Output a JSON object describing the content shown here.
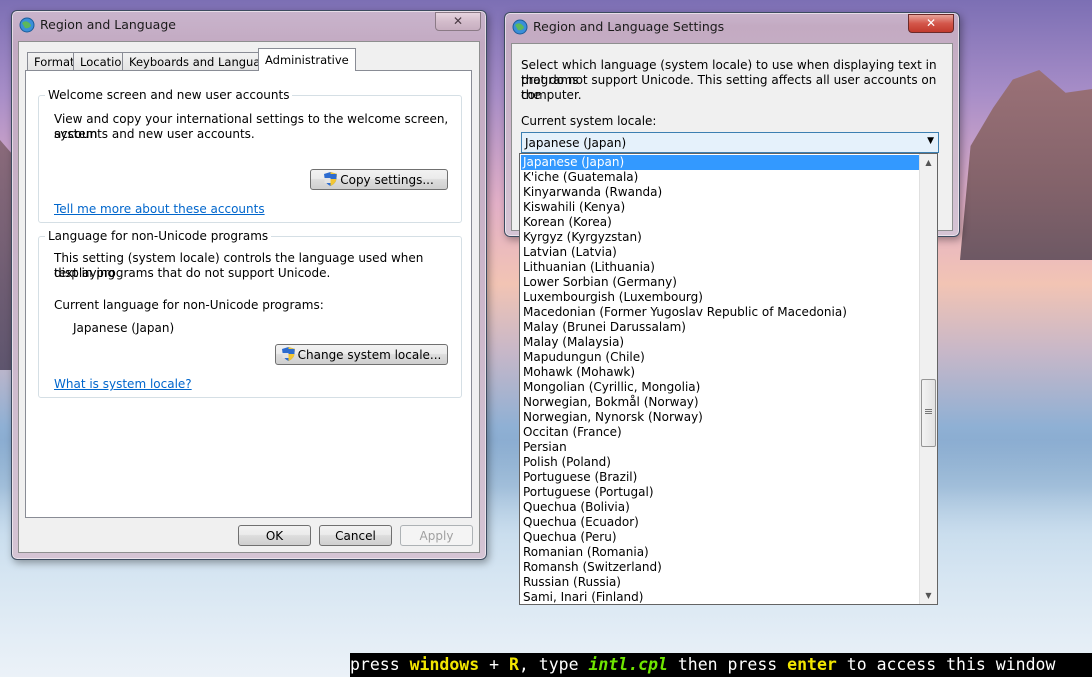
{
  "window1": {
    "title": "Region and Language",
    "close_label": "✕",
    "tabs": [
      "Formats",
      "Location",
      "Keyboards and Languages",
      "Administrative"
    ],
    "group1": {
      "title": "Welcome screen and new user accounts",
      "description_line1": "View and copy your international settings to the welcome screen, system",
      "description_line2": "accounts and new user accounts.",
      "copy_button": "Copy settings...",
      "link": "Tell me more about these accounts"
    },
    "group2": {
      "title": "Language for non-Unicode programs",
      "description_line1": "This setting (system locale) controls the language used when displaying",
      "description_line2": "text in programs that do not support Unicode.",
      "current_label": "Current language for non-Unicode programs:",
      "current_value": "Japanese (Japan)",
      "change_button": "Change system locale...",
      "link": "What is system locale?"
    },
    "buttons": {
      "ok": "OK",
      "cancel": "Cancel",
      "apply": "Apply"
    }
  },
  "window2": {
    "title": "Region and Language Settings",
    "close_label": "✕",
    "description_line1": "Select which language (system locale) to use when displaying text in programs",
    "description_line2": "that do not support Unicode. This setting affects all user accounts on the",
    "description_line3": "computer.",
    "locale_label": "Current system locale:",
    "selected_locale": "Japanese (Japan)",
    "locale_options": [
      "Japanese (Japan)",
      "K'iche (Guatemala)",
      "Kinyarwanda (Rwanda)",
      "Kiswahili (Kenya)",
      "Korean (Korea)",
      "Kyrgyz (Kyrgyzstan)",
      "Latvian (Latvia)",
      "Lithuanian (Lithuania)",
      "Lower Sorbian (Germany)",
      "Luxembourgish (Luxembourg)",
      "Macedonian (Former Yugoslav Republic of Macedonia)",
      "Malay (Brunei Darussalam)",
      "Malay (Malaysia)",
      "Mapudungun (Chile)",
      "Mohawk (Mohawk)",
      "Mongolian (Cyrillic, Mongolia)",
      "Norwegian, Bokmål (Norway)",
      "Norwegian, Nynorsk (Norway)",
      "Occitan (France)",
      "Persian",
      "Polish (Poland)",
      "Portuguese (Brazil)",
      "Portuguese (Portugal)",
      "Quechua (Bolivia)",
      "Quechua (Ecuador)",
      "Quechua (Peru)",
      "Romanian (Romania)",
      "Romansh (Switzerland)",
      "Russian (Russia)",
      "Sami, Inari (Finland)"
    ]
  },
  "instruction": {
    "p1": "press ",
    "k1": "windows",
    "p2": " + ",
    "k2": "R",
    "p3": ", type ",
    "k3": "intl.cpl",
    "p4": " then press ",
    "k4": "enter",
    "p5": " to access this window"
  },
  "colors": {
    "selection": "#3399ff",
    "link": "#0066cc",
    "close_active": "#c23a2d"
  }
}
